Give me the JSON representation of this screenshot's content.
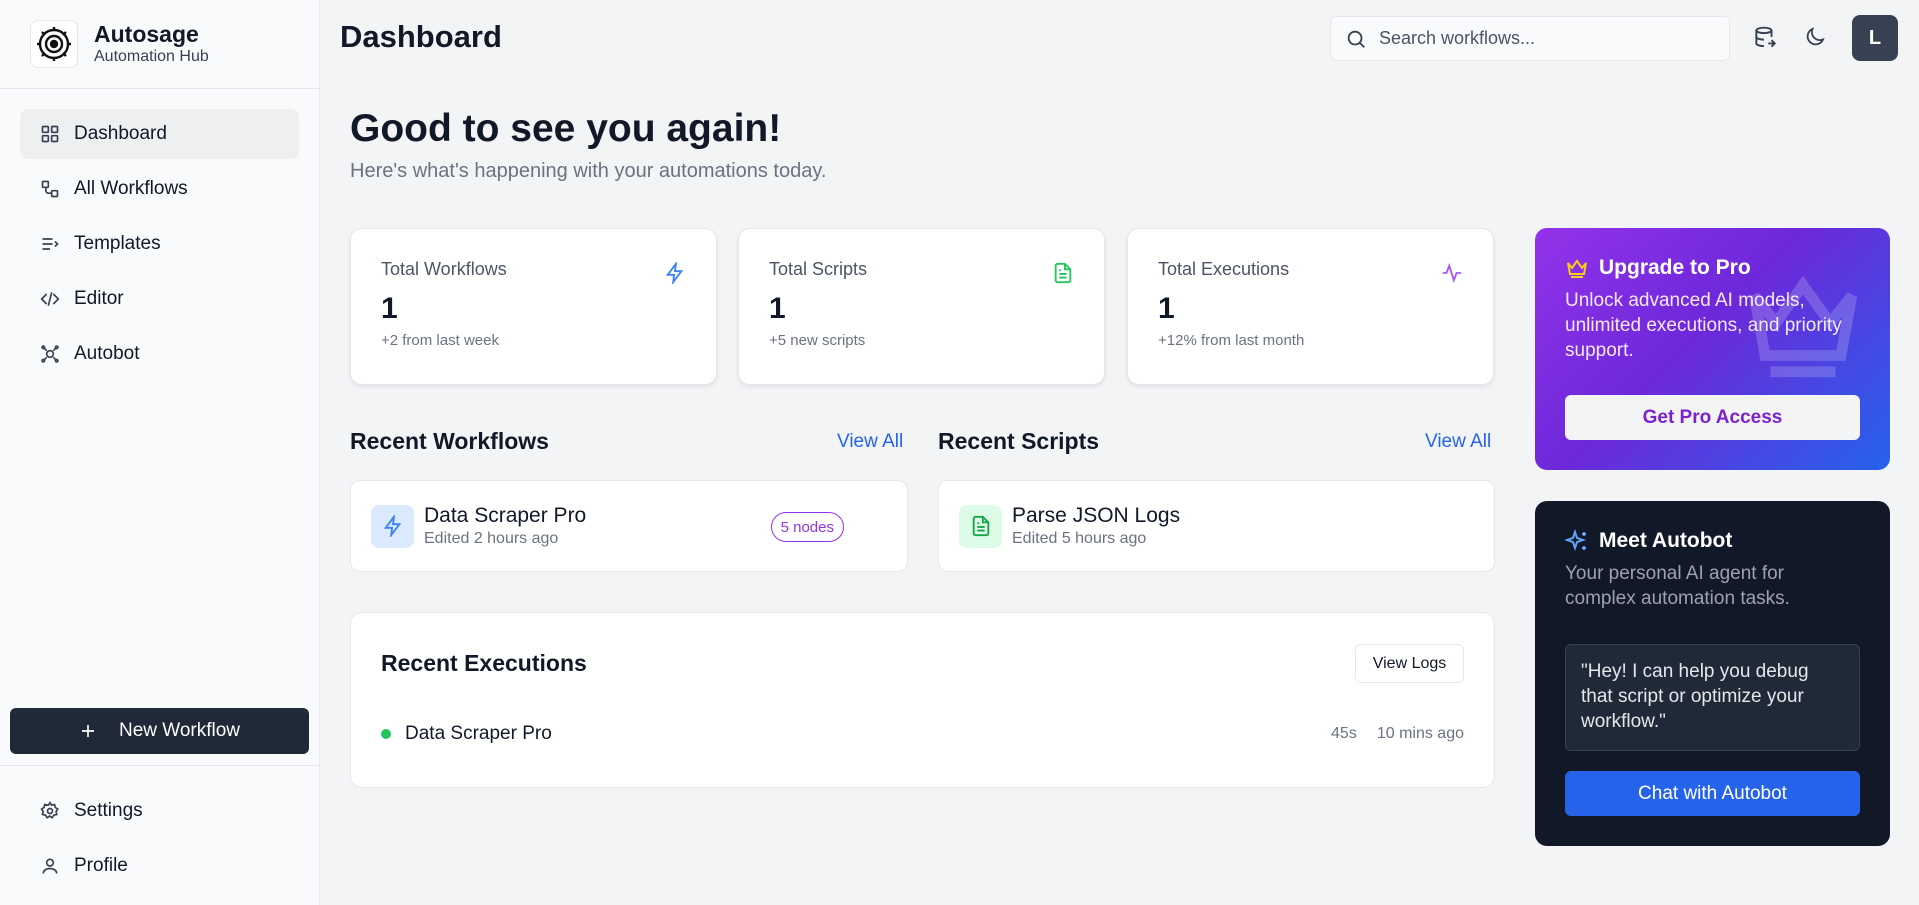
{
  "brand": {
    "name": "Autosage",
    "subtitle": "Automation Hub"
  },
  "sidebar": {
    "items": [
      {
        "label": "Dashboard",
        "icon": "grid-icon",
        "active": true
      },
      {
        "label": "All Workflows",
        "icon": "workflow-icon"
      },
      {
        "label": "Templates",
        "icon": "list-icon"
      },
      {
        "label": "Editor",
        "icon": "code-icon"
      },
      {
        "label": "Autobot",
        "icon": "bot-icon"
      }
    ],
    "new_workflow_label": "New Workflow",
    "bottom_items": [
      {
        "label": "Settings",
        "icon": "gear-icon"
      },
      {
        "label": "Profile",
        "icon": "user-icon"
      }
    ]
  },
  "header": {
    "title": "Dashboard",
    "search_placeholder": "Search workflows...",
    "avatar_initial": "L"
  },
  "main": {
    "welcome_title": "Good to see you again!",
    "welcome_subtitle": "Here's what's happening with your automations today.",
    "stats": [
      {
        "label": "Total Workflows",
        "value": "1",
        "note": "+2 from last week",
        "icon": "bolt-icon",
        "color": "#3b82f6"
      },
      {
        "label": "Total Scripts",
        "value": "1",
        "note": "+5 new scripts",
        "icon": "file-icon",
        "color": "#22c55e"
      },
      {
        "label": "Total Executions",
        "value": "1",
        "note": "+12% from last month",
        "icon": "activity-icon",
        "color": "#a855f7"
      }
    ],
    "recent_workflows": {
      "title": "Recent Workflows",
      "view_all": "View All",
      "items": [
        {
          "name": "Data Scraper Pro",
          "edited": "Edited 2 hours ago",
          "badge": "5 nodes"
        }
      ]
    },
    "recent_scripts": {
      "title": "Recent Scripts",
      "view_all": "View All",
      "items": [
        {
          "name": "Parse JSON Logs",
          "edited": "Edited 5 hours ago"
        }
      ]
    },
    "recent_executions": {
      "title": "Recent Executions",
      "view_logs": "View Logs",
      "items": [
        {
          "name": "Data Scraper Pro",
          "duration": "45s",
          "time": "10 mins ago",
          "status_color": "#22c55e"
        }
      ]
    }
  },
  "pro": {
    "title": "Upgrade to Pro",
    "text": "Unlock advanced AI models, unlimited executions, and priority support.",
    "button": "Get Pro Access"
  },
  "autobot": {
    "title": "Meet Autobot",
    "text": "Your personal AI agent for complex automation tasks.",
    "quote": "\"Hey! I can help you debug that script or optimize your workflow.\"",
    "button": "Chat with Autobot"
  }
}
